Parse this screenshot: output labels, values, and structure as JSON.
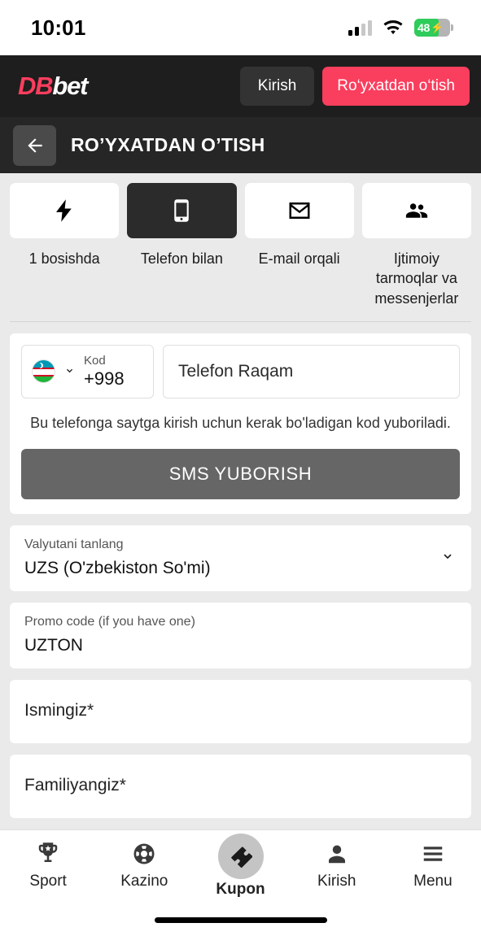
{
  "status_bar": {
    "time": "10:01",
    "battery_percent": "48",
    "battery_bolt": "⚡",
    "signal_bars_filled": 2,
    "signal_bars_total": 4
  },
  "brand_header": {
    "logo_first": "DB",
    "logo_second": "bet",
    "login_label": "Kirish",
    "register_label": "Ro‘yxatdan o‘tish",
    "accent_color": "#fa3e5e",
    "background_color": "#1e1e1e"
  },
  "title_bar": {
    "title": "RO’YXATDAN O’TISH",
    "back_icon": "arrow-left-icon"
  },
  "reg_methods": {
    "tabs": [
      {
        "label": "1 bosishda",
        "icon": "lightning-bolt-icon",
        "active": false
      },
      {
        "label": "Telefon bilan",
        "icon": "mobile-phone-icon",
        "active": true
      },
      {
        "label": "E-mail orqali",
        "icon": "envelope-icon",
        "active": false
      },
      {
        "label": "Ijtimoiy tarmoqlar va messenjerlar",
        "icon": "people-group-icon",
        "active": false
      }
    ]
  },
  "phone_section": {
    "code_label": "Kod",
    "code_value": "+998",
    "flag": "uzbekistan-flag-icon",
    "phone_placeholder": "Telefon Raqam",
    "phone_value": "",
    "hint": "Bu telefonga saytga kirish uchun kerak bo'ladigan kod yuboriladi.",
    "submit_label": "SMS YUBORISH",
    "submit_enabled": false
  },
  "currency_field": {
    "label": "Valyutani tanlang",
    "value": "UZS  (O'zbekiston So'mi)"
  },
  "promo_field": {
    "label": "Promo code (if you have one)",
    "value": "UZTON"
  },
  "first_name_field": {
    "placeholder": "Ismingiz*"
  },
  "last_name_field": {
    "placeholder": "Familiyangiz*"
  },
  "bottom_nav": {
    "items": [
      {
        "label": "Sport",
        "icon": "trophy-icon",
        "active": false
      },
      {
        "label": "Kazino",
        "icon": "casino-chip-icon",
        "active": false
      },
      {
        "label": "Kupon",
        "icon": "ticket-icon",
        "active": true
      },
      {
        "label": "Kirish",
        "icon": "person-icon",
        "active": false
      },
      {
        "label": "Menu",
        "icon": "hamburger-menu-icon",
        "active": false
      }
    ]
  }
}
